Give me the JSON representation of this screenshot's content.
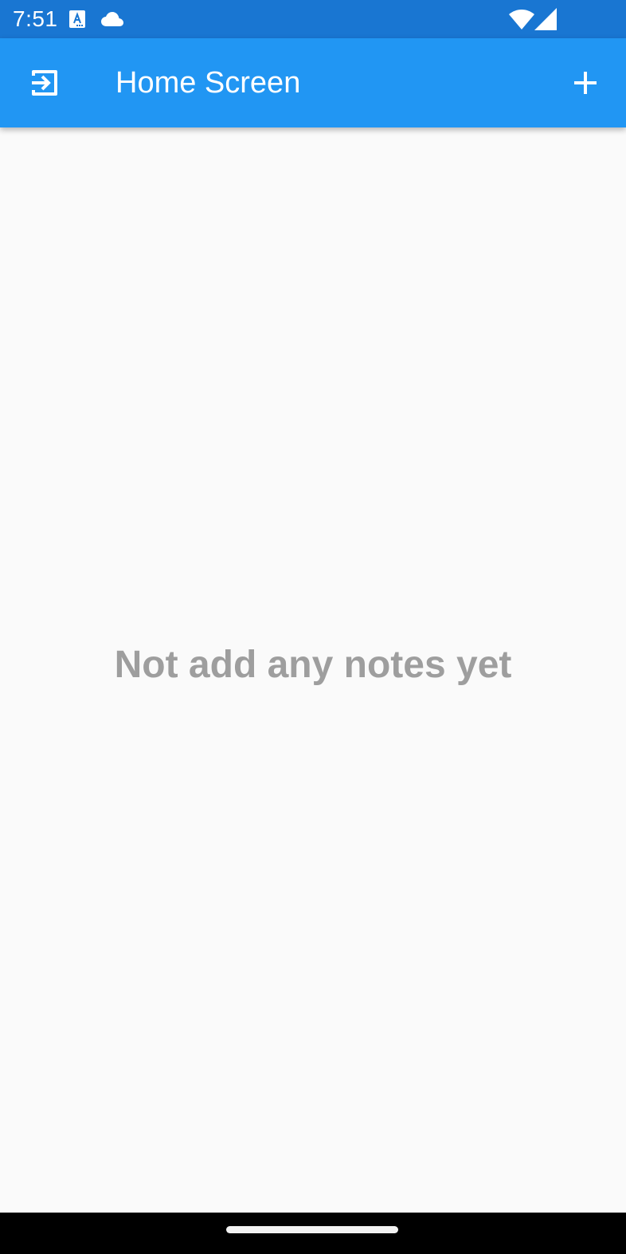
{
  "status_bar": {
    "time": "7:51",
    "icons": [
      "translate-a-icon",
      "cloud-icon",
      "wifi-icon",
      "cellular-signal-icon"
    ]
  },
  "app_bar": {
    "title": "Home Screen",
    "leading_icon": "logout-icon",
    "action_icon": "add-icon",
    "color": "#2196F3"
  },
  "main": {
    "empty_message": "Not add any notes yet"
  },
  "colors": {
    "status_bar": "#1976D2",
    "app_bar": "#2196F3",
    "background": "#FAFAFA",
    "empty_text": "#9E9E9E",
    "nav_bar": "#000000"
  }
}
